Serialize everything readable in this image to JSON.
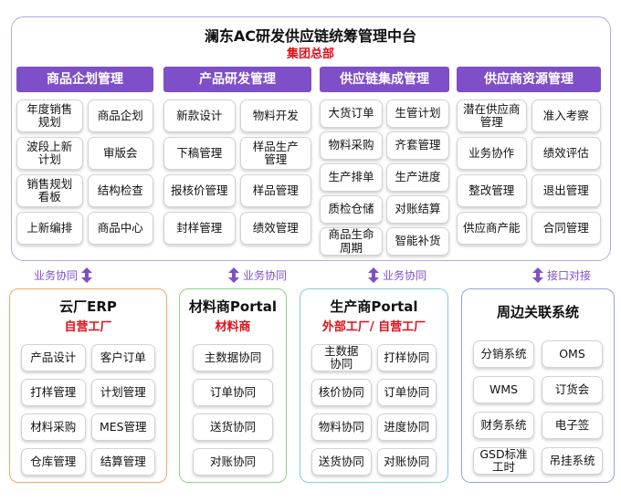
{
  "header": {
    "title": "澜东AC研发供应链统筹管理中台",
    "subtitle": "集团总部"
  },
  "columns": [
    {
      "header": "商品企划管理",
      "items": [
        "年度销售\n规划",
        "商品企划",
        "波段上新\n计划",
        "审版会",
        "销售规划\n看板",
        "结构检查",
        "上新编排",
        "商品中心"
      ]
    },
    {
      "header": "产品研发管理",
      "items": [
        "新款设计",
        "物料开发",
        "下稿管理",
        "样品生产\n管理",
        "报核价管理",
        "样品管理",
        "封样管理",
        "绩效管理"
      ]
    },
    {
      "header": "供应链集成管理",
      "items": [
        "大货订单",
        "生管计划",
        "物料采购",
        "齐套管理",
        "生产排单",
        "生产进度",
        "质检仓储",
        "对账结算",
        "商品生命\n周期",
        "智能补货"
      ]
    },
    {
      "header": "供应商资源管理",
      "items": [
        "潜在供应商\n管理",
        "准入考察",
        "业务协作",
        "绩效评估",
        "整改管理",
        "退出管理",
        "供应商产能",
        "合同管理"
      ]
    }
  ],
  "connectors": [
    "业务协同",
    "业务协同",
    "业务协同",
    "接口对接"
  ],
  "systems": [
    {
      "title": "云厂ERP",
      "subtitle": "自营工厂",
      "border": "#f4a46a",
      "items": [
        "产品设计",
        "客户订单",
        "打样管理",
        "计划管理",
        "材料采购",
        "MES管理",
        "仓库管理",
        "结算管理"
      ]
    },
    {
      "title": "材料商Portal",
      "subtitle": "材料商",
      "border": "#8fd08a",
      "items": [
        "主数据协同",
        "订单协同",
        "送货协同",
        "对账协同"
      ]
    },
    {
      "title": "生产商Portal",
      "subtitle": "外部工厂/ 自营工厂",
      "border": "#7fd0cc",
      "items": [
        "主数据\n协同",
        "打样协同",
        "核价协同",
        "订单协同",
        "物料协同",
        "进度协同",
        "送货协同",
        "对账协同"
      ]
    },
    {
      "title": "周边关联系统",
      "subtitle": "",
      "border": "#8ea6d6",
      "items": [
        "分销系统",
        "OMS",
        "WMS",
        "订货会",
        "财务系统",
        "电子签",
        "GSD标准\n工时",
        "吊挂系统"
      ]
    }
  ],
  "colors": {
    "accent": "#7f4fc9",
    "highlight": "#e0101a",
    "frame": "#b9a6e3"
  }
}
